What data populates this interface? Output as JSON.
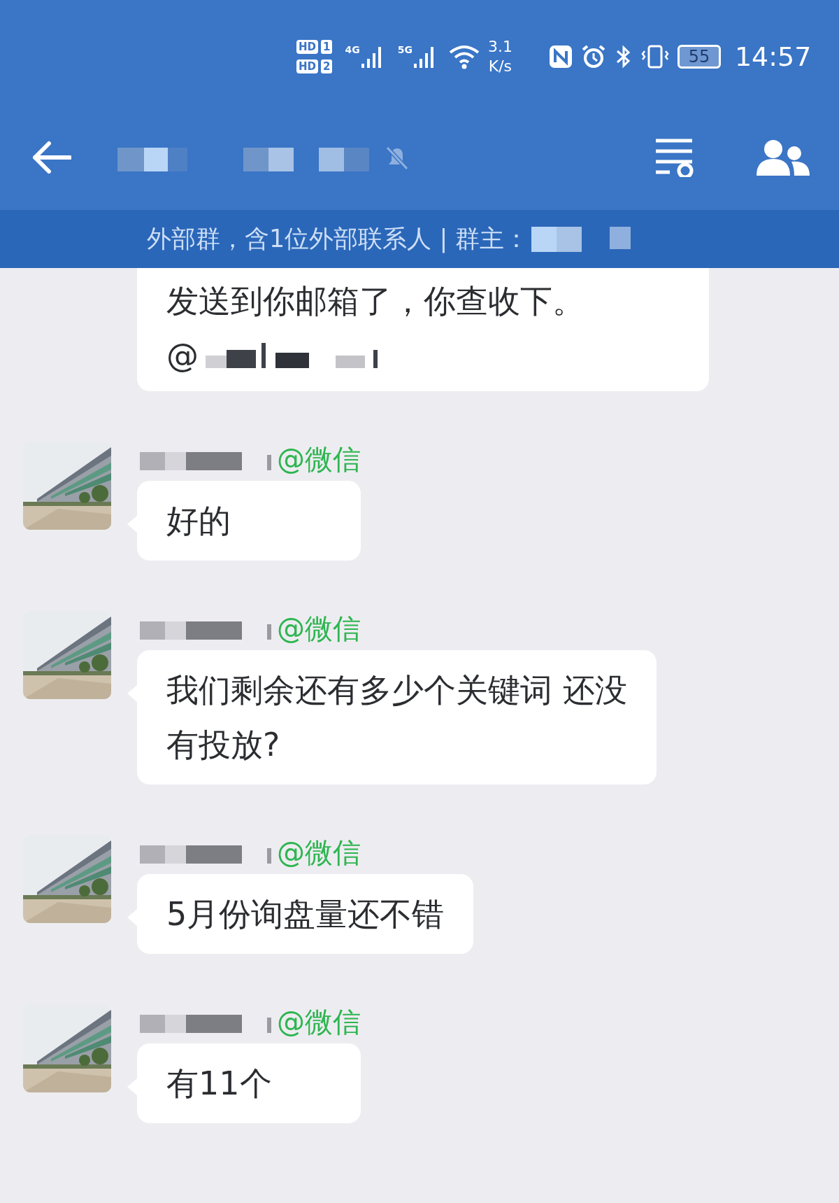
{
  "status_bar": {
    "sim_labels": [
      "HD",
      "1",
      "HD",
      "2"
    ],
    "networks": [
      "4G",
      "5G"
    ],
    "speed": [
      "3.1",
      "K/s"
    ],
    "battery": "55",
    "time": "14:57"
  },
  "header": {
    "muted": true
  },
  "subheader": {
    "text": "外部群，含1位外部联系人 | 群主："
  },
  "messages": [
    {
      "kind": "continued",
      "lines": [
        "发送到你邮箱了，你查收下。"
      ],
      "mention": "@"
    },
    {
      "kind": "message",
      "source": "@微信",
      "lines": [
        "好的"
      ]
    },
    {
      "kind": "message",
      "source": "@微信",
      "lines": [
        "我们剩余还有多少个关键词 还没",
        "有投放?"
      ]
    },
    {
      "kind": "message",
      "source": "@微信",
      "lines": [
        "5月份询盘量还不错"
      ]
    },
    {
      "kind": "message",
      "source": "@微信",
      "lines": [
        "有11个"
      ]
    }
  ]
}
